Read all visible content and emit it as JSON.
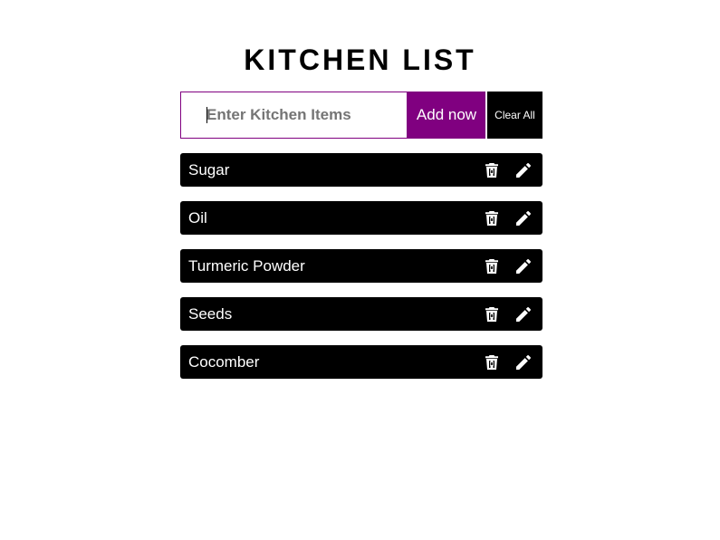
{
  "app": {
    "title": "KITCHEN LIST"
  },
  "form": {
    "input_value": "",
    "input_placeholder": "Enter Kitchen Items",
    "add_label": "Add now",
    "clear_label": "Clear All"
  },
  "items": [
    {
      "label": "Sugar"
    },
    {
      "label": "Oil"
    },
    {
      "label": "Turmeric Powder"
    },
    {
      "label": "Seeds"
    },
    {
      "label": "Cocomber"
    }
  ],
  "icons": {
    "delete": "trash-icon",
    "edit": "pencil-icon"
  },
  "colors": {
    "accent": "#800080",
    "item_background": "#000000",
    "item_text": "#ffffff"
  }
}
